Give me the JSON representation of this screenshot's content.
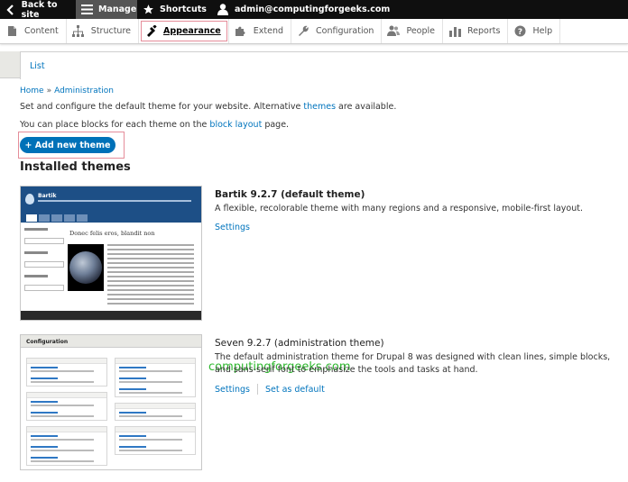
{
  "toolbar": {
    "back_label": "Back to site",
    "manage_label": "Manage",
    "shortcuts_label": "Shortcuts",
    "user_label": "admin@computingforgeeks.com"
  },
  "menu": {
    "items": [
      {
        "label": "Content",
        "icon": "content-icon"
      },
      {
        "label": "Structure",
        "icon": "structure-icon"
      },
      {
        "label": "Appearance",
        "icon": "appearance-icon",
        "active": true
      },
      {
        "label": "Extend",
        "icon": "extend-icon"
      },
      {
        "label": "Configuration",
        "icon": "configuration-icon"
      },
      {
        "label": "People",
        "icon": "people-icon"
      },
      {
        "label": "Reports",
        "icon": "reports-icon"
      },
      {
        "label": "Help",
        "icon": "help-icon"
      }
    ]
  },
  "tabs": {
    "list_label": "List"
  },
  "breadcrumb": {
    "home": "Home",
    "separator": "»",
    "admin": "Administration"
  },
  "description": {
    "line1_before": "Set and configure the default theme for your website. Alternative ",
    "line1_link": "themes",
    "line1_after": " are available.",
    "line2_before": "You can place blocks for each theme on the ",
    "line2_link": "block layout",
    "line2_after": " page."
  },
  "add_button_label": "+ Add new theme",
  "installed_title": "Installed themes",
  "themes": [
    {
      "name": "Bartik 9.2.7 (default theme)",
      "description": "A flexible, recolorable theme with many regions and a responsive, mobile-first layout.",
      "links": [
        "Settings"
      ],
      "thumb": {
        "site_title": "Bartik",
        "heading": "Donec felis eros, blandit non"
      }
    },
    {
      "name": "Seven 9.2.7 (administration theme)",
      "description": "The default administration theme for Drupal 8 was designed with clean lines, simple blocks, and sans-serif font to emphasize the tools and tasks at hand.",
      "links": [
        "Settings",
        "Set as default"
      ],
      "thumb": {
        "page_title": "Configuration"
      }
    }
  ],
  "watermark": "computingforgeeks.com",
  "colors": {
    "toolbar_bg": "#0f0f0f",
    "link": "#0074bd",
    "primary_button": "#0071b8",
    "highlight_frame": "#e58d9a",
    "watermark": "#2eb82e"
  }
}
